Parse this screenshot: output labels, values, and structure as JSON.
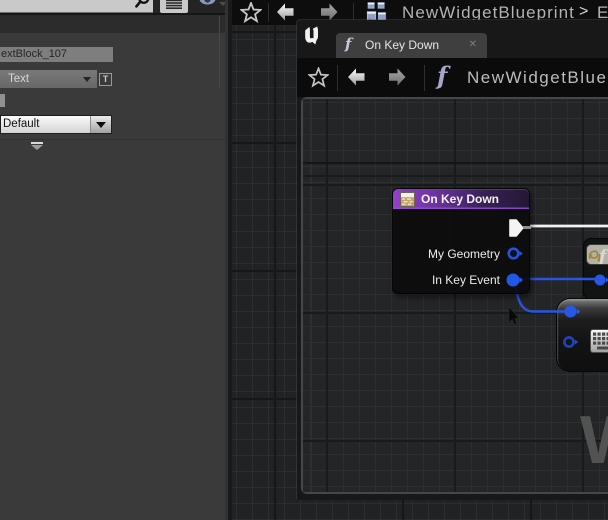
{
  "colors": {
    "accent_blue_pin": "#2658e8",
    "exec_wire": "#f2f2f2",
    "node_header_purple": "#9a4ed2",
    "panel_bg": "#3a3a3a",
    "graph_bg": "#242527"
  },
  "details_panel": {
    "name_field": {
      "value": "extBlock_107"
    },
    "font_family_dropdown": {
      "value": "Text"
    },
    "text_style_button": {
      "label": "T"
    },
    "style_combo": {
      "value": "Default"
    }
  },
  "top_bar": {
    "breadcrumb": "NewWidgetBlueprint",
    "chevron": ">",
    "next_partial": "E"
  },
  "window": {
    "tab": {
      "icon": "f",
      "label": "On Key Down",
      "close": "✕"
    },
    "toolbar": {
      "icon": "f",
      "breadcrumb": "NewWidgetBlue"
    },
    "graph": {
      "watermark": "W",
      "node_f": {
        "icon": "f"
      },
      "node": {
        "title": "On Key Down",
        "pin_rows": {
          "row1": "My Geometry",
          "row2": "In Key Event"
        }
      }
    }
  }
}
